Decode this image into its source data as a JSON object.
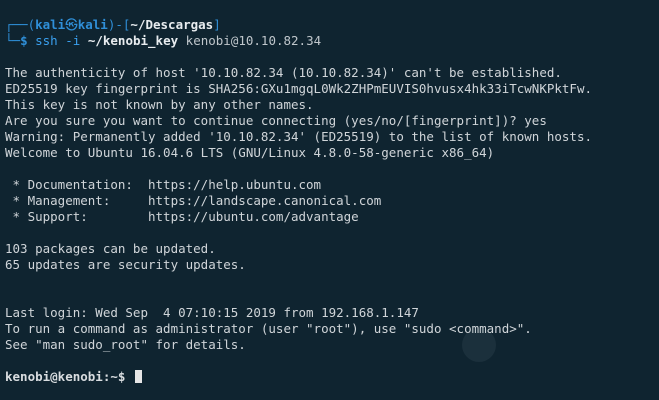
{
  "prompt1": {
    "frame_top": "┌──(",
    "user": "kali",
    "skull": "㉿",
    "host": "kali",
    "frame_mid": ")-[",
    "path": "~/Descargas",
    "frame_end": "]",
    "frame_bottom": "└─",
    "dollar": "$",
    "command": "ssh",
    "flag": "-i",
    "keyfile": "~/kenobi_key",
    "target": "kenobi@10.10.82.34"
  },
  "output_lines": [
    "The authenticity of host '10.10.82.34 (10.10.82.34)' can't be established.",
    "ED25519 key fingerprint is SHA256:GXu1mgqL0Wk2ZHPmEUVIS0hvusx4hk33iTcwNKPktFw.",
    "This key is not known by any other names.",
    "Are you sure you want to continue connecting (yes/no/[fingerprint])? yes",
    "Warning: Permanently added '10.10.82.34' (ED25519) to the list of known hosts.",
    "Welcome to Ubuntu 16.04.6 LTS (GNU/Linux 4.8.0-58-generic x86_64)"
  ],
  "docs_lines": [
    " * Documentation:  https://help.ubuntu.com",
    " * Management:     https://landscape.canonical.com",
    " * Support:        https://ubuntu.com/advantage"
  ],
  "update_lines": [
    "103 packages can be updated.",
    "65 updates are security updates."
  ],
  "login_lines": [
    "Last login: Wed Sep  4 07:10:15 2019 from 192.168.1.147",
    "To run a command as administrator (user \"root\"), use \"sudo <command>\".",
    "See \"man sudo_root\" for details."
  ],
  "prompt2": {
    "text": "kenobi@kenobi:~$"
  },
  "colors": {
    "background": "#0f2430",
    "accent": "#2f8fd8",
    "text": "#d9dde0"
  }
}
